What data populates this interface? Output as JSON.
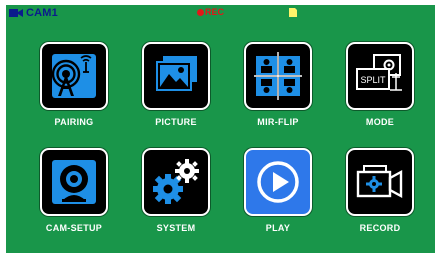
{
  "status": {
    "camera_label": "CAM1",
    "rec_label": "REC",
    "camera_icon": "camera-icon",
    "sd_icon": "sd-card-icon"
  },
  "menu": {
    "items": [
      {
        "label": "PAIRING",
        "icon": "antenna-icon"
      },
      {
        "label": "PICTURE",
        "icon": "picture-icon"
      },
      {
        "label": "MIR-FLIP",
        "icon": "mirror-flip-icon"
      },
      {
        "label": "MODE",
        "icon": "split-mode-icon"
      },
      {
        "label": "CAM-SETUP",
        "icon": "webcam-icon"
      },
      {
        "label": "SYSTEM",
        "icon": "gears-icon"
      },
      {
        "label": "PLAY",
        "icon": "play-icon"
      },
      {
        "label": "RECORD",
        "icon": "record-camera-icon"
      }
    ],
    "selected": "PLAY"
  },
  "mode_icon_text": "SPLIT",
  "colors": {
    "background": "#19964a",
    "button": "#000000",
    "selected_button": "#2e78ea",
    "icon_blue": "#1e8fe6",
    "label": "#ffffff",
    "cam_label": "#0b1c8c",
    "rec": "#e01818"
  }
}
